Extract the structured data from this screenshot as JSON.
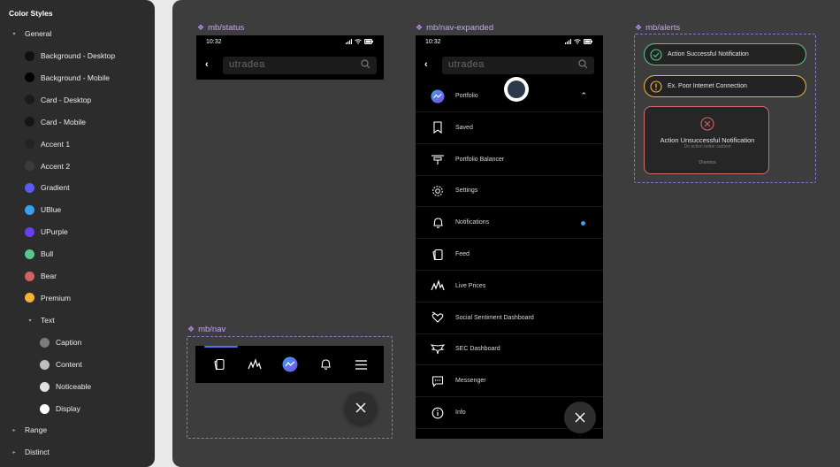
{
  "panel": {
    "title": "Color Styles",
    "groups": [
      {
        "label": "General",
        "caret": "▾"
      },
      {
        "label": "Range",
        "caret": "▸"
      },
      {
        "label": "Distinct",
        "caret": "▸"
      }
    ],
    "general_items": [
      {
        "label": "Background - Desktop",
        "color": "#101010"
      },
      {
        "label": "Background - Mobile",
        "color": "#000000"
      },
      {
        "label": "Card - Desktop",
        "color": "#1b1b1b"
      },
      {
        "label": "Card - Mobile",
        "color": "#151515"
      },
      {
        "label": "Accent 1",
        "color": "#232323"
      },
      {
        "label": "Accent 2",
        "color": "#3b3b3b"
      },
      {
        "label": "Gradient",
        "color": "#5a5cf0"
      },
      {
        "label": "UBlue",
        "color": "#3d9fec"
      },
      {
        "label": "UPurple",
        "color": "#6a3ef0"
      },
      {
        "label": "Bull",
        "color": "#57c88a"
      },
      {
        "label": "Bear",
        "color": "#d06262"
      },
      {
        "label": "Premium",
        "color": "#f1b434"
      }
    ],
    "text_group": {
      "label": "Text",
      "caret": "▾"
    },
    "text_items": [
      {
        "label": "Caption",
        "color": "#7d7d7d"
      },
      {
        "label": "Content",
        "color": "#bfbfbf"
      },
      {
        "label": "Noticeable",
        "color": "#e2e2e2"
      },
      {
        "label": "Display",
        "color": "#ffffff"
      }
    ]
  },
  "frames": {
    "status": {
      "label": "mb/status",
      "time": "10:32",
      "search_text": "utradea"
    },
    "nav": {
      "label": "mb/nav"
    },
    "expanded": {
      "label": "mb/nav-expanded",
      "time": "10:32",
      "search_text": "utradea",
      "items": [
        {
          "label": "Portfolio",
          "icon": "portfolio-icon"
        },
        {
          "label": "Saved",
          "icon": "bookmark-icon"
        },
        {
          "label": "Portfolio Balancer",
          "icon": "balancer-icon"
        },
        {
          "label": "Settings",
          "icon": "gear-icon"
        },
        {
          "label": "Notifications",
          "icon": "bell-icon"
        },
        {
          "label": "Feed",
          "icon": "feed-icon"
        },
        {
          "label": "Live Prices",
          "icon": "live-prices-icon"
        },
        {
          "label": "Social Sentiment Dashboard",
          "icon": "sentiment-icon"
        },
        {
          "label": "SEC Dashboard",
          "icon": "sec-icon"
        },
        {
          "label": "Messenger",
          "icon": "messenger-icon"
        },
        {
          "label": "Info",
          "icon": "info-icon"
        }
      ]
    },
    "alerts": {
      "label": "mb/alerts",
      "success": "Action Successful Notification",
      "warning": "Ex. Poor Internet Connection",
      "error_title": "Action Unsuccessful Notification",
      "error_sub": "Do action better subtext",
      "dismiss": "Dismiss"
    }
  },
  "colors": {
    "accent": "#b98df0",
    "success": "#57c88a",
    "warning": "#f1b434",
    "error": "#d06262",
    "ublue": "#3d9fec"
  }
}
